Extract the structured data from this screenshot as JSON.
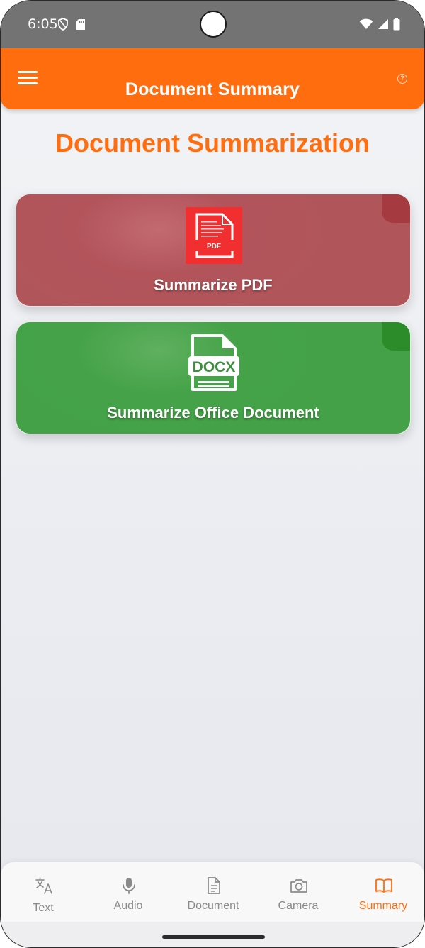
{
  "status_bar": {
    "time": "6:05",
    "left_icons": [
      "shield-icon",
      "sd-card-icon"
    ],
    "right_icons": [
      "wifi-icon",
      "signal-icon",
      "battery-icon"
    ]
  },
  "app_bar": {
    "title": "Document Summary",
    "menu_icon": "hamburger-menu-icon",
    "help_icon": "help-circle-icon",
    "help_glyph": "?"
  },
  "main": {
    "heading": "Document Summarization",
    "cards": [
      {
        "label": "Summarize PDF",
        "icon": "pdf-icon",
        "icon_text": "PDF",
        "color": "#b3545b"
      },
      {
        "label": "Summarize Office Document",
        "icon": "docx-icon",
        "icon_text": "DOCX",
        "color": "#45a248"
      }
    ]
  },
  "bottom_nav": {
    "active": "Summary",
    "accent": "#ff6d0f",
    "items": [
      {
        "label": "Text",
        "icon": "translate-icon"
      },
      {
        "label": "Audio",
        "icon": "microphone-icon"
      },
      {
        "label": "Document",
        "icon": "document-icon"
      },
      {
        "label": "Camera",
        "icon": "camera-icon"
      },
      {
        "label": "Summary",
        "icon": "open-book-icon"
      }
    ]
  }
}
